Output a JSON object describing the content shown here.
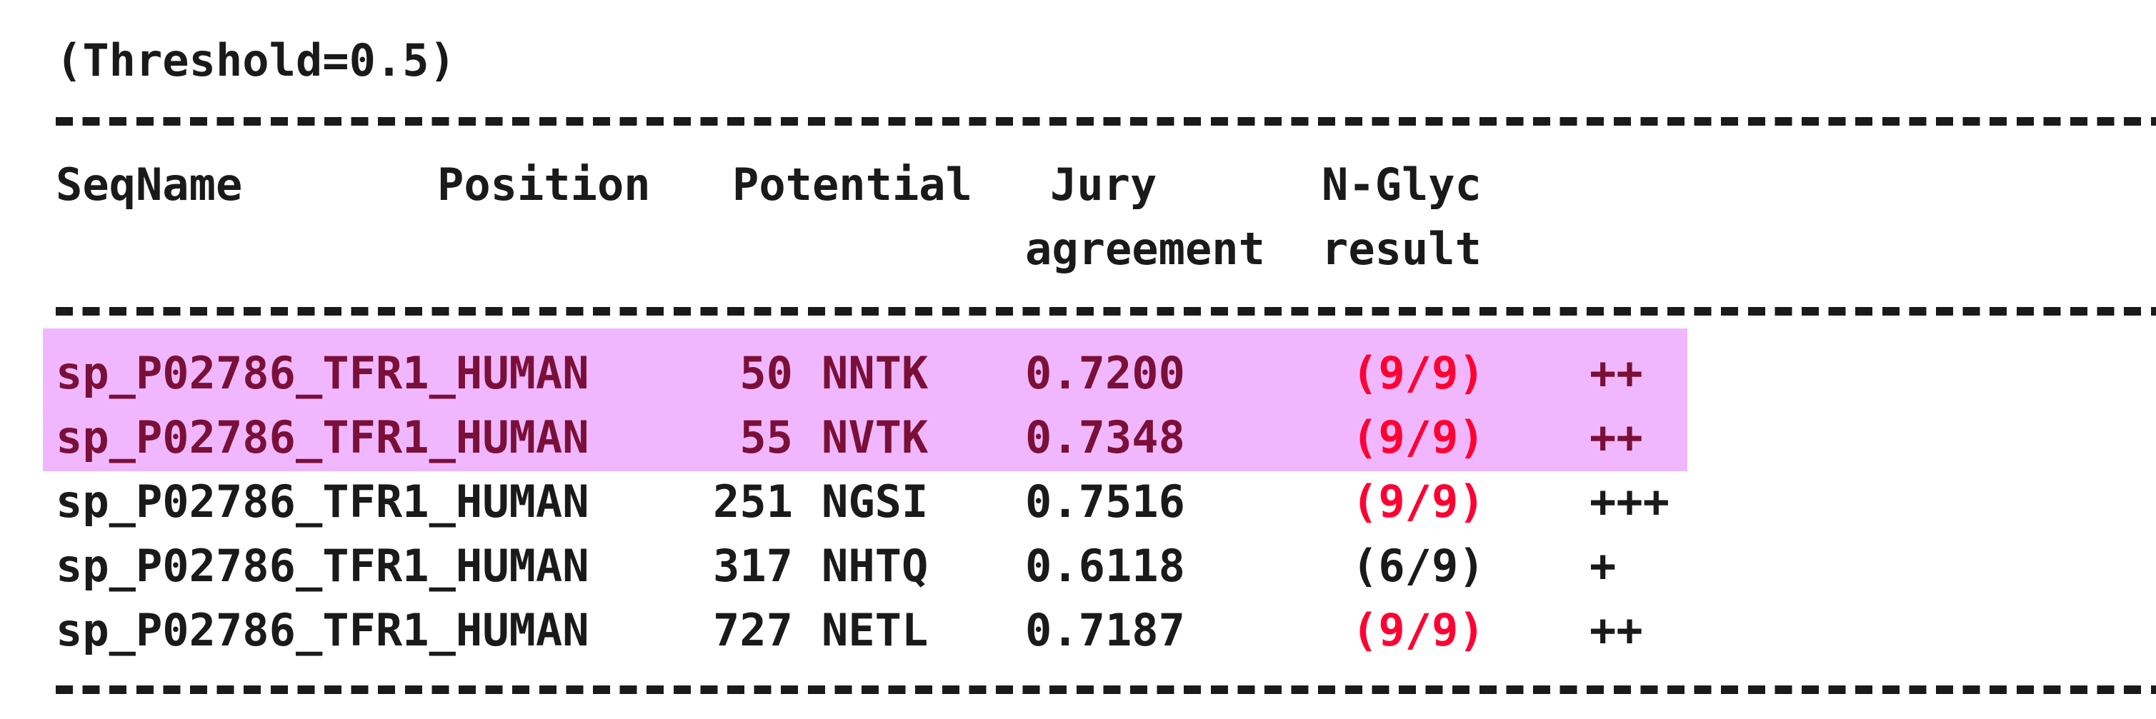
{
  "threshold_line": "(Threshold=0.5)",
  "headers": {
    "seqname": "SeqName",
    "position": "Position",
    "potential": "Potential",
    "jury_top": "Jury",
    "jury_bottom": "agreement",
    "nglyc_top": "N-Glyc",
    "nglyc_bottom": "result"
  },
  "rows": [
    {
      "seqname": "sp_P02786_TFR1_HUMAN",
      "position": "50",
      "motif": "NNTK",
      "potential": "0.7200",
      "jury": "(9/9)",
      "result": "++",
      "highlighted": true,
      "jury_color": "#ff0033"
    },
    {
      "seqname": "sp_P02786_TFR1_HUMAN",
      "position": "55",
      "motif": "NVTK",
      "potential": "0.7348",
      "jury": "(9/9)",
      "result": "++",
      "highlighted": true,
      "jury_color": "#ff0033"
    },
    {
      "seqname": "sp_P02786_TFR1_HUMAN",
      "position": "251",
      "motif": "NGSI",
      "potential": "0.7516",
      "jury": "(9/9)",
      "result": "+++",
      "highlighted": false,
      "jury_color": "#ff0033"
    },
    {
      "seqname": "sp_P02786_TFR1_HUMAN",
      "position": "317",
      "motif": "NHTQ",
      "potential": "0.6118",
      "jury": "(6/9)",
      "result": "+",
      "highlighted": false,
      "jury_color": "#1a1a1a"
    },
    {
      "seqname": "sp_P02786_TFR1_HUMAN",
      "position": "727",
      "motif": "NETL",
      "potential": "0.7187",
      "jury": "(9/9)",
      "result": "++",
      "highlighted": false,
      "jury_color": "#ff0033"
    }
  ],
  "colors": {
    "highlight_background": "#f0b7ff",
    "highlight_text": "#7a1038",
    "jury_full_agreement": "#ff0033",
    "default_text": "#1a1a1a"
  }
}
